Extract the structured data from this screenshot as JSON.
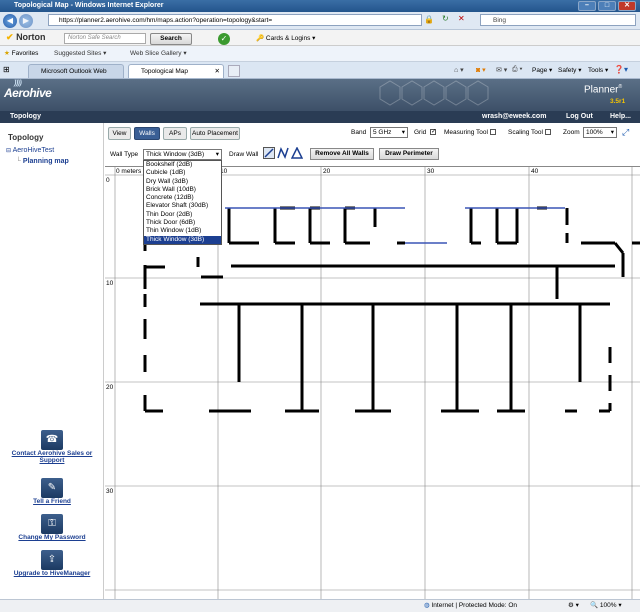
{
  "window": {
    "title": "Topological Map - Windows Internet Explorer"
  },
  "browser": {
    "url": "https://planner2.aerohive.com/hm/maps.action?operation=topology&start=",
    "search_placeholder": "Bing",
    "norton": {
      "brand": "Norton",
      "search_placeholder": "Norton Safe Search",
      "search_button": "Search",
      "cards_logins": "Cards & Logins"
    },
    "favorites": {
      "label": "Favorites",
      "suggested": "Suggested Sites",
      "web_slice": "Web Slice Gallery"
    },
    "tabs": [
      {
        "label": "Microsoft Outlook Web Access"
      },
      {
        "label": "Topological Map"
      }
    ],
    "commands": {
      "page": "Page",
      "safety": "Safety",
      "tools": "Tools"
    }
  },
  "app": {
    "logo": "Aerohive",
    "product": "Planner",
    "version": "3.5r1",
    "nav_tab": "Topology",
    "user": "wrash@eweek.com",
    "logout": "Log Out",
    "help": "Help..."
  },
  "sidebar": {
    "heading": "Topology",
    "tree_root": "AeroHiveTest",
    "tree_child": "Planning map",
    "links": [
      {
        "label": "Contact Aerohive Sales or Support",
        "icon": "contact-support-icon"
      },
      {
        "label": "Tell a Friend",
        "icon": "tell-friend-icon"
      },
      {
        "label": "Change My Password",
        "icon": "password-icon"
      },
      {
        "label": "Upgrade to HiveManager",
        "icon": "upgrade-icon"
      }
    ]
  },
  "toolbar": {
    "tabs": [
      "View",
      "Walls",
      "APs",
      "Auto Placement"
    ],
    "band_label": "Band",
    "band_value": "5 GHz",
    "grid_label": "Grid",
    "measuring_label": "Measuring Tool",
    "scaling_label": "Scaling Tool",
    "zoom_label": "Zoom",
    "zoom_value": "100%"
  },
  "walls_bar": {
    "wall_type_label": "Wall Type",
    "wall_type_value": "Thick Window (3dB)",
    "draw_wall_label": "Draw Wall",
    "remove_all": "Remove All Walls",
    "draw_perimeter": "Draw Perimeter",
    "options": [
      "Bookshelf (2dB)",
      "Cubicle (1dB)",
      "Dry Wall (3dB)",
      "Brick Wall (10dB)",
      "Concrete (12dB)",
      "Elevator Shaft (30dB)",
      "Thin Door (2dB)",
      "Thick Door (6dB)",
      "Thin Window (1dB)",
      "Thick Window (3dB)"
    ]
  },
  "map": {
    "x_axis": [
      "0 meters",
      "10",
      "20",
      "30",
      "40"
    ],
    "y_axis": [
      "0",
      "10",
      "20",
      "30"
    ]
  },
  "status": {
    "zone": "Internet | Protected Mode: On",
    "zoom": "100%"
  }
}
